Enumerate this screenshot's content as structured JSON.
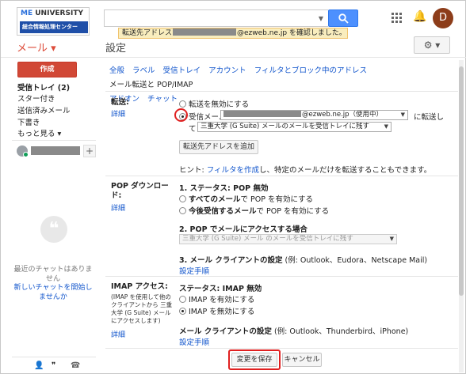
{
  "header": {
    "logo_top_brand": "ME",
    "logo_top_rest": "UNIVERSITY",
    "logo_bar": "総合情報処理センター",
    "notice_prefix": "転送先アドレス",
    "notice_suffix": "@ezweb.ne.jp を確認しました。",
    "avatar_initial": "D"
  },
  "nav": {
    "mail_label": "メール ▾",
    "page_title": "設定",
    "settings_gear": "⚙ ▾"
  },
  "sidebar": {
    "compose": "作成",
    "items": [
      "受信トレイ (2)",
      "スター付き",
      "送信済みメール",
      "下書き",
      "もっと見る ▾"
    ],
    "chat_empty": "最近のチャットはありません",
    "chat_start": "新しいチャットを開始しませんか",
    "add_icon": "+"
  },
  "tabs": [
    "全般",
    "ラベル",
    "受信トレイ",
    "アカウント",
    "フィルタとブロック中のアドレス",
    "メール転送と POP/IMAP",
    "アドオン",
    "チャット"
  ],
  "active_tab_index": 5,
  "forwarding": {
    "label": "転送:",
    "details": "詳細",
    "disable": "転送を無効にする",
    "enable_prefix": "受信メールを",
    "enable_address": "@ezweb.ne.jp（使用中）",
    "enable_suffix": "に転送し",
    "te": "て",
    "keep_option": "三重大学 (G Suite) メールのメールを受信トレイに残す",
    "add_button": "転送先アドレスを追加",
    "hint_prefix": "ヒント: ",
    "hint_link": "フィルタを作成",
    "hint_suffix": "し、特定のメールだけを転送することもできます。"
  },
  "pop": {
    "label": "POP ダウンロード:",
    "details": "詳細",
    "status": "1. ステータス: POP 無効",
    "all_mail_bold": "すべてのメール",
    "all_mail_rest": "で POP を有効にする",
    "from_now_bold": "今後受信するメール",
    "from_now_rest": "で POP を有効にする",
    "access_title": "2. POP でメールにアクセスする場合",
    "access_option": "三重大学 (G Suite) メール のメールを受信トレイに残す",
    "client_title": "3. メール クライアントの設定",
    "client_examples": "(例: Outlook、Eudora、Netscape Mail)",
    "setup": "設定手順"
  },
  "imap": {
    "label": "IMAP アクセス:",
    "note": "(IMAP を使用して他のクライアントから 三重大学 (G Suite) メール にアクセスします)",
    "details": "詳細",
    "status": "ステータス: IMAP 無効",
    "enable": "IMAP を有効にする",
    "disable": "IMAP を無効にする",
    "client_title": "メール クライアントの設定",
    "client_examples": "(例: Outlook、Thunderbird、iPhone)",
    "setup": "設定手順"
  },
  "footer": {
    "save": "変更を保存",
    "cancel": "キャンセル"
  },
  "colors": {
    "accent_red": "#dd4b39",
    "link_blue": "#1155cc",
    "search_blue": "#4d90fe",
    "highlight_red": "#e02020"
  }
}
